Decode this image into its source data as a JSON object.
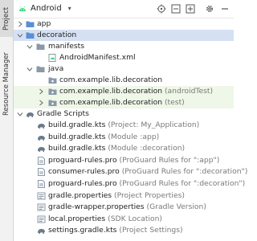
{
  "side_tabs": {
    "project": "Project",
    "resource_manager": "Resource Manager"
  },
  "toolbar": {
    "view": "Android",
    "icons": [
      "android-icon",
      "chevron-down-icon",
      "crosshair-icon",
      "collapse-all-icon",
      "expand-all-icon",
      "gear-icon",
      "minimize-icon"
    ]
  },
  "tree": {
    "app": "app",
    "decoration": "decoration",
    "manifests": "manifests",
    "manifest_file": "AndroidManifest.xml",
    "java": "java",
    "pkg1": "com.example.lib.decoration",
    "pkg2": "com.example.lib.decoration",
    "pkg2_tag": "(androidTest)",
    "pkg3": "com.example.lib.decoration",
    "pkg3_tag": "(test)",
    "gradle_scripts": "Gradle Scripts",
    "files": [
      {
        "name": "build.gradle.kts",
        "note": "(Project: My_Application)",
        "icon": "gradle-icon"
      },
      {
        "name": "build.gradle.kts",
        "note": "(Module :app)",
        "icon": "gradle-icon"
      },
      {
        "name": "build.gradle.kts",
        "note": "(Module :decoration)",
        "icon": "gradle-icon"
      },
      {
        "name": "proguard-rules.pro",
        "note": "(ProGuard Rules for \":app\")",
        "icon": "file-icon"
      },
      {
        "name": "consumer-rules.pro",
        "note": "(ProGuard Rules for \":decoration\")",
        "icon": "file-icon"
      },
      {
        "name": "proguard-rules.pro",
        "note": "(ProGuard Rules for \":decoration\")",
        "icon": "file-icon"
      },
      {
        "name": "gradle.properties",
        "note": "(Project Properties)",
        "icon": "properties-icon"
      },
      {
        "name": "gradle-wrapper.properties",
        "note": "(Gradle Version)",
        "icon": "properties-icon"
      },
      {
        "name": "local.properties",
        "note": "(SDK Location)",
        "icon": "properties-icon"
      },
      {
        "name": "settings.gradle.kts",
        "note": "(Project Settings)",
        "icon": "gradle-icon"
      }
    ]
  },
  "colors": {
    "selection": "#d5e1f2",
    "test_source_bg": "#eef7e8",
    "folder_module": "#5a8fd6",
    "folder_plain": "#8b98a8",
    "android_green": "#3ddc84"
  }
}
